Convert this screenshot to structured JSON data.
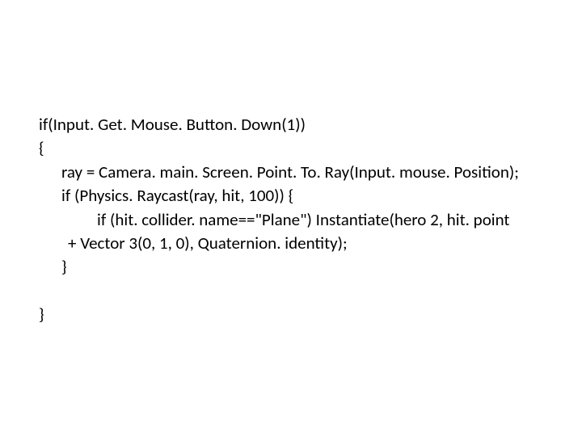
{
  "code": {
    "l1": "if(Input. Get. Mouse. Button. Down(1))",
    "l2": "{",
    "l3": "ray = Camera. main. Screen. Point. To. Ray(Input. mouse. Position);",
    "l4": "if (Physics. Raycast(ray, hit, 100)) {",
    "l5": "if (hit. collider. name==\"Plane\") Instantiate(hero 2, hit. point",
    "l6": "+ Vector 3(0, 1, 0), Quaternion. identity);",
    "l7": "}",
    "l8": "}"
  }
}
